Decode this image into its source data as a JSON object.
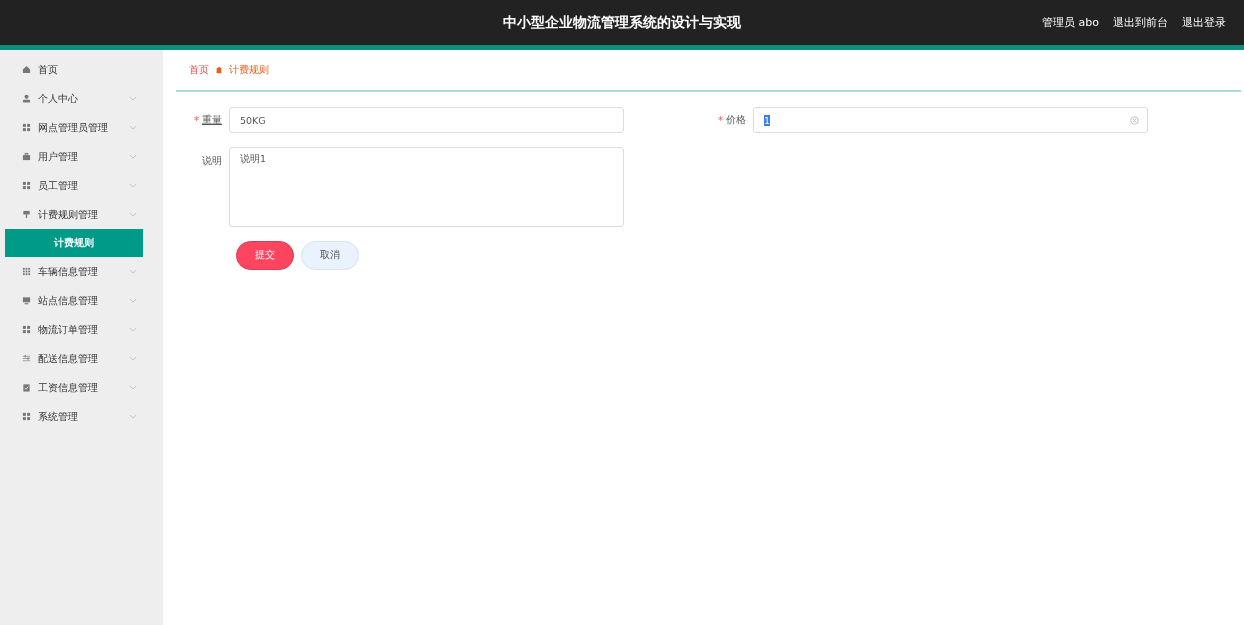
{
  "header": {
    "title": "中小型企业物流管理系统的设计与实现",
    "links": [
      "管理员 abo",
      "退出到前台",
      "退出登录"
    ]
  },
  "sidebar": {
    "items": [
      {
        "label": "首页",
        "kind": "home",
        "chevron": false
      },
      {
        "label": "个人中心",
        "kind": "person",
        "chevron": true
      },
      {
        "label": "网点管理员管理",
        "kind": "grid",
        "chevron": true
      },
      {
        "label": "用户管理",
        "kind": "briefcase",
        "chevron": true
      },
      {
        "label": "员工管理",
        "kind": "grid",
        "chevron": true
      },
      {
        "label": "计费规则管理",
        "kind": "pin",
        "chevron": true,
        "children": [
          {
            "label": "计费规则",
            "selected": true
          }
        ]
      },
      {
        "label": "车辆信息管理",
        "kind": "apps",
        "chevron": true
      },
      {
        "label": "站点信息管理",
        "kind": "monitor",
        "chevron": true
      },
      {
        "label": "物流订单管理",
        "kind": "grid",
        "chevron": true
      },
      {
        "label": "配送信息管理",
        "kind": "sliders",
        "chevron": true
      },
      {
        "label": "工资信息管理",
        "kind": "clipboard",
        "chevron": true
      },
      {
        "label": "系统管理",
        "kind": "grid",
        "chevron": true
      }
    ]
  },
  "breadcrumb": [
    "首页",
    "计费规则"
  ],
  "form": {
    "fields": [
      {
        "required_mark": "*",
        "label": "重量",
        "value": "50KG",
        "text_selected": false,
        "clearable": false
      },
      {
        "required_mark": "*",
        "label": "价格",
        "value": "1",
        "text_selected": true,
        "clearable": true
      }
    ],
    "description": {
      "label": "说明",
      "value": "说明1"
    },
    "buttons": [
      {
        "label": "提交",
        "kind": "primary"
      },
      {
        "label": "取消",
        "kind": "secondary"
      }
    ]
  }
}
